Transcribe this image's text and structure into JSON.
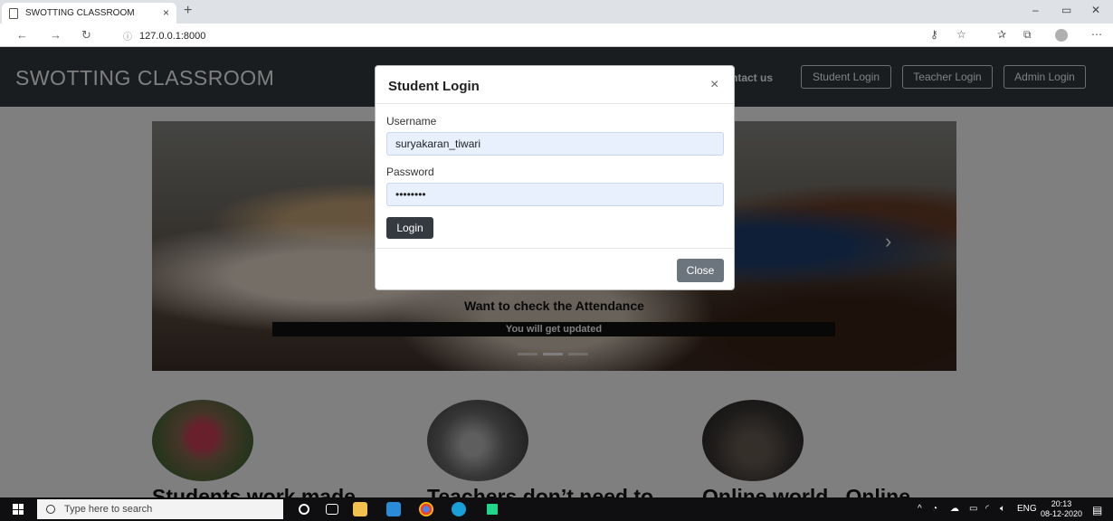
{
  "browser": {
    "tab_title": "SWOTTING CLASSROOM",
    "tab_close": "×",
    "new_tab": "+",
    "url": "127.0.0.1:8000",
    "window_controls": {
      "minimize": "–",
      "restore": "▭",
      "close": "✕"
    }
  },
  "site": {
    "brand": "SWOTTING CLASSROOM",
    "nav_contact": "ntact us",
    "nav_buttons": [
      "Student Login",
      "Teacher Login",
      "Admin Login"
    ]
  },
  "carousel": {
    "caption_title": "Want to check the Attendance",
    "caption_sub": "You will get updated",
    "next_arrow": "›"
  },
  "features": [
    "Students work made",
    "Teachers don’t need to",
    "Online world...Online"
  ],
  "modal": {
    "title": "Student Login",
    "close_x": "×",
    "username_label": "Username",
    "username_value": "suryakaran_tiwari",
    "password_label": "Password",
    "password_value": "••••••••",
    "login_button": "Login",
    "close_button": "Close"
  },
  "taskbar": {
    "search_placeholder": "Type here to search",
    "language": "ENG",
    "time": "20:13",
    "date": "08-12-2020"
  },
  "colors": {
    "navbar": "#343a40",
    "input_autofill": "#e8f0fe",
    "close_button": "#6c757d"
  }
}
